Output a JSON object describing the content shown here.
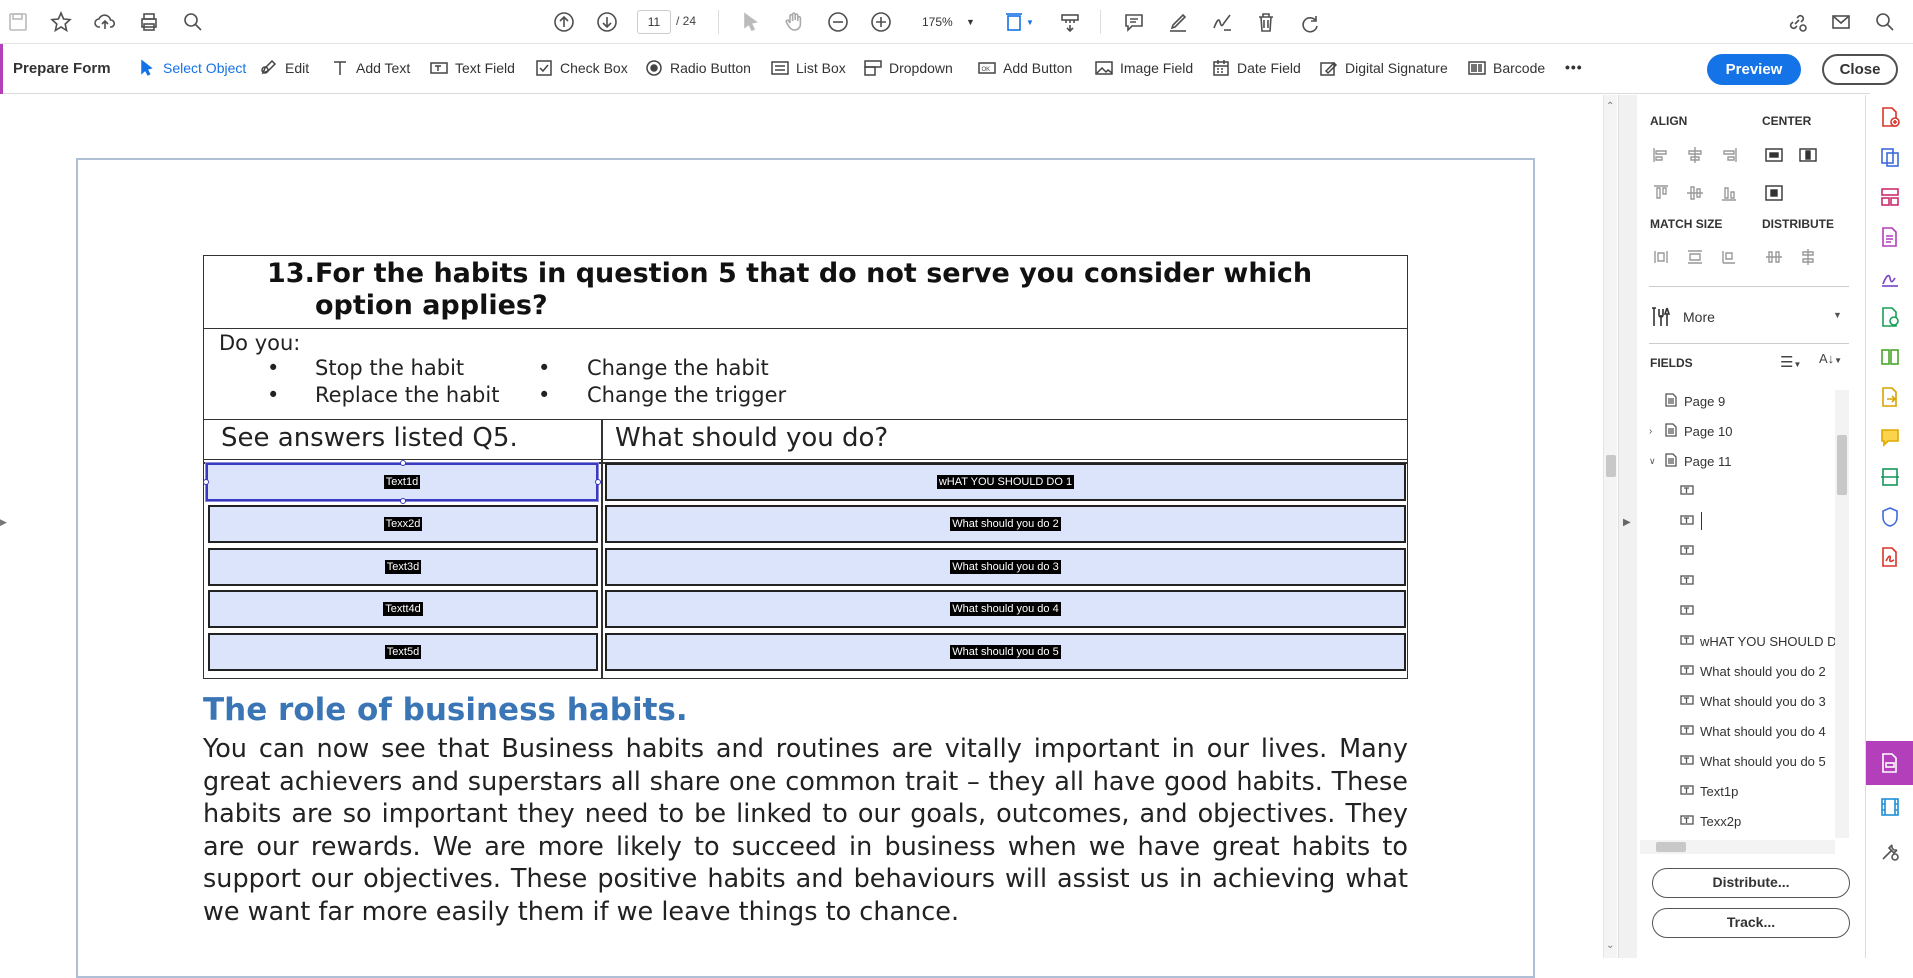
{
  "toolbar": {
    "page_current": "11",
    "page_total": "/ 24",
    "zoom": "175%"
  },
  "formbar": {
    "title": "Prepare Form",
    "tools": [
      {
        "label": "Select Object"
      },
      {
        "label": "Edit"
      },
      {
        "label": "Add Text"
      },
      {
        "label": "Text Field"
      },
      {
        "label": "Check Box"
      },
      {
        "label": "Radio Button"
      },
      {
        "label": "List Box"
      },
      {
        "label": "Dropdown"
      },
      {
        "label": "Add Button"
      },
      {
        "label": "Image Field"
      },
      {
        "label": "Date Field"
      },
      {
        "label": "Digital Signature"
      },
      {
        "label": "Barcode"
      }
    ],
    "more": "•••",
    "preview": "Preview",
    "close": "Close"
  },
  "document": {
    "question_number": "13.",
    "question_text": "For the habits in question 5 that do not serve you consider which option applies?",
    "do_you": "Do you:",
    "bullets": [
      "Stop the habit",
      "Change the habit",
      "Replace the habit",
      "Change the trigger"
    ],
    "col_left_header": "See answers listed Q5.",
    "col_right_header": "What should you do?",
    "left_fields": [
      "Text1d",
      "Texx2d",
      "Text3d",
      "Textt4d",
      "Text5d"
    ],
    "right_fields": [
      "wHAT YOU SHOULD DO 1",
      "What should you do 2",
      "What should you do 3",
      "What should you do 4",
      "What should you do 5"
    ],
    "heading": "The role of business habits.",
    "paragraph": "You can now see that Business habits and routines are vitally important in our lives. Many great achievers and superstars all share one common trait – they all have good habits. These habits are so important they need to be linked to our goals, outcomes, and objectives. They are our rewards. We are more likely to succeed in business when we have great habits to support our objectives. These positive habits and behaviours will assist us in achieving what we want far more easily them if we leave things to chance."
  },
  "panel": {
    "align": "ALIGN",
    "center": "CENTER",
    "match_size": "MATCH SIZE",
    "distribute": "DISTRIBUTE",
    "more": "More",
    "fields": "FIELDS",
    "tree": [
      "Page 9",
      "Page 10",
      "Page 11",
      "",
      "",
      "",
      "",
      "",
      "wHAT YOU SHOULD D",
      "What should you do 2",
      "What should you do 3",
      "What should you do 4",
      "What should you do 5",
      "Text1p",
      "Texx2p"
    ],
    "distribute_btn": "Distribute...",
    "track_btn": "Track..."
  },
  "colors": {
    "accent_purple": "#b33fba",
    "preview_blue": "#1473e6",
    "heading_blue": "#3a75b5",
    "field_fill": "#dce4fb"
  }
}
